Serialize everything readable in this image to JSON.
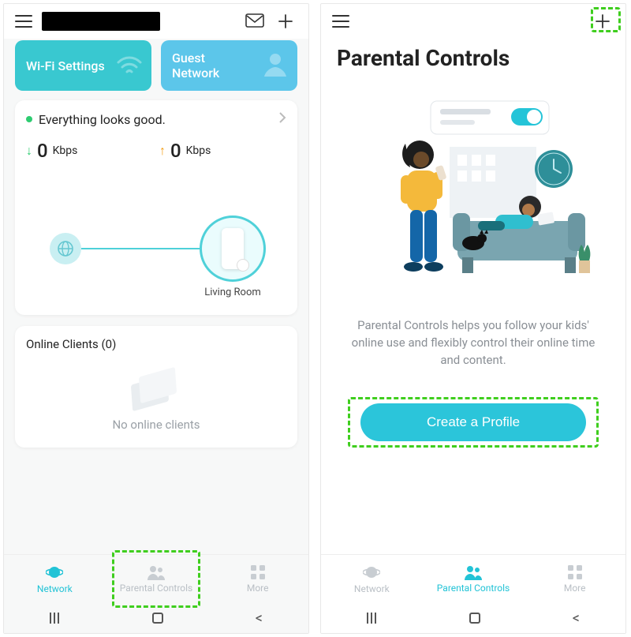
{
  "left": {
    "cards": {
      "wifi": "Wi-Fi Settings",
      "guest": "Guest\nNetwork"
    },
    "status": {
      "text": "Everything looks good."
    },
    "speeds": {
      "down": {
        "value": "0",
        "unit": "Kbps"
      },
      "up": {
        "value": "0",
        "unit": "Kbps"
      }
    },
    "device": {
      "name": "Living Room"
    },
    "clients": {
      "title": "Online Clients (0)",
      "empty": "No online clients"
    },
    "nav": {
      "network": "Network",
      "parental": "Parental Controls",
      "more": "More"
    }
  },
  "right": {
    "title": "Parental Controls",
    "desc": "Parental Controls helps you follow your kids' online use and flexibly control their online time and content.",
    "cta": "Create a Profile",
    "nav": {
      "network": "Network",
      "parental": "Parental Controls",
      "more": "More"
    }
  }
}
